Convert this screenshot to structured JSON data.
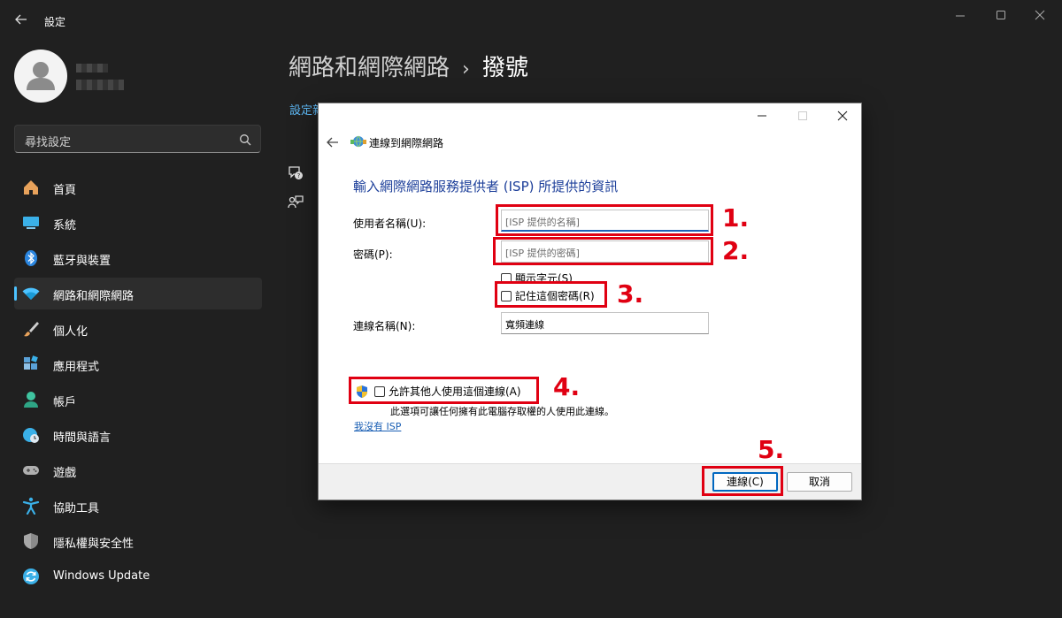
{
  "window": {
    "title": "設定",
    "controls": {
      "minimize": "minimize-icon",
      "maximize": "maximize-icon",
      "close": "close-icon"
    }
  },
  "search": {
    "placeholder": "尋找設定"
  },
  "sidebar": {
    "items": [
      {
        "label": "首頁",
        "icon": "home-icon",
        "color": "#e8a25b"
      },
      {
        "label": "系統",
        "icon": "monitor-icon",
        "color": "#3ab0e8"
      },
      {
        "label": "藍牙與裝置",
        "icon": "bluetooth-icon",
        "color": "#2b86e0"
      },
      {
        "label": "網路和網際網路",
        "icon": "wifi-icon",
        "color": "#4cc2ff",
        "active": true
      },
      {
        "label": "個人化",
        "icon": "brush-icon",
        "color": "#e8a25b"
      },
      {
        "label": "應用程式",
        "icon": "apps-icon",
        "color": "#8ec0e6"
      },
      {
        "label": "帳戶",
        "icon": "account-icon",
        "color": "#3fc4a0"
      },
      {
        "label": "時間與語言",
        "icon": "globe-clock-icon",
        "color": "#3ab0e8"
      },
      {
        "label": "遊戲",
        "icon": "gamepad-icon",
        "color": "#a0a0a0"
      },
      {
        "label": "協助工具",
        "icon": "accessibility-icon",
        "color": "#3ab0e8"
      },
      {
        "label": "隱私權與安全性",
        "icon": "shield-icon",
        "color": "#8a8a8a"
      },
      {
        "label": "Windows Update",
        "icon": "update-icon",
        "color": "#3ab0e8"
      }
    ]
  },
  "header": {
    "breadcrumb_parent": "網路和網際網路",
    "separator": "›",
    "breadcrumb_current": "撥號",
    "link_partial": "設定新"
  },
  "dialog": {
    "title": "連線到網際網路",
    "heading": "輸入網際網路服務提供者 (ISP) 所提供的資訊",
    "username_label": "使用者名稱(U):",
    "username_placeholder": "[ISP 提供的名稱]",
    "password_label": "密碼(P):",
    "password_placeholder": "[ISP 提供的密碼]",
    "show_chars": "顯示字元(S)",
    "remember_pw": "記住這個密碼(R)",
    "conn_name_label": "連線名稱(N):",
    "conn_name_value": "寬頻連線",
    "allow_others": "允許其他人使用這個連線(A)",
    "allow_note": "此選項可讓任何擁有此電腦存取權的人使用此連線。",
    "no_isp_link": "我沒有 ISP",
    "connect_button": "連線(C)",
    "cancel_button": "取消"
  },
  "annotations": [
    "1.",
    "2.",
    "3.",
    "4.",
    "5."
  ],
  "colors": {
    "accent": "#4cc2ff",
    "annotation": "#e00012",
    "dialog_heading": "#1d3f9a"
  }
}
